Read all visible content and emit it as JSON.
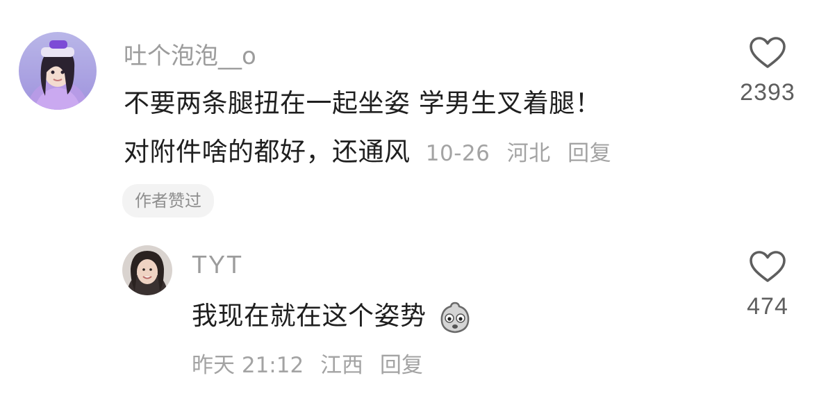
{
  "comments": [
    {
      "username": "吐个泡泡__o",
      "text_lines": [
        "不要两条腿扭在一起坐姿   学男生叉着腿！",
        "对附件啥的都好，还通风"
      ],
      "date": "10-26",
      "location": "河北",
      "reply_label": "回复",
      "likes": "2393",
      "badge": "作者赞过",
      "avatar_icon": "avatar-girl-purple-hoodie"
    },
    {
      "username": "TYT",
      "text": "我现在就在这个姿势",
      "emoji": "nervous-face-emoji",
      "time": "昨天 21:12",
      "location": "江西",
      "reply_label": "回复",
      "likes": "474",
      "avatar_icon": "avatar-girl-smiling"
    }
  ],
  "colors": {
    "username": "#9c9c9c",
    "text": "#1f1f1f",
    "meta": "#a3a3a3",
    "badge_bg": "#f3f3f3",
    "like_icon": "#5e5e5e"
  }
}
